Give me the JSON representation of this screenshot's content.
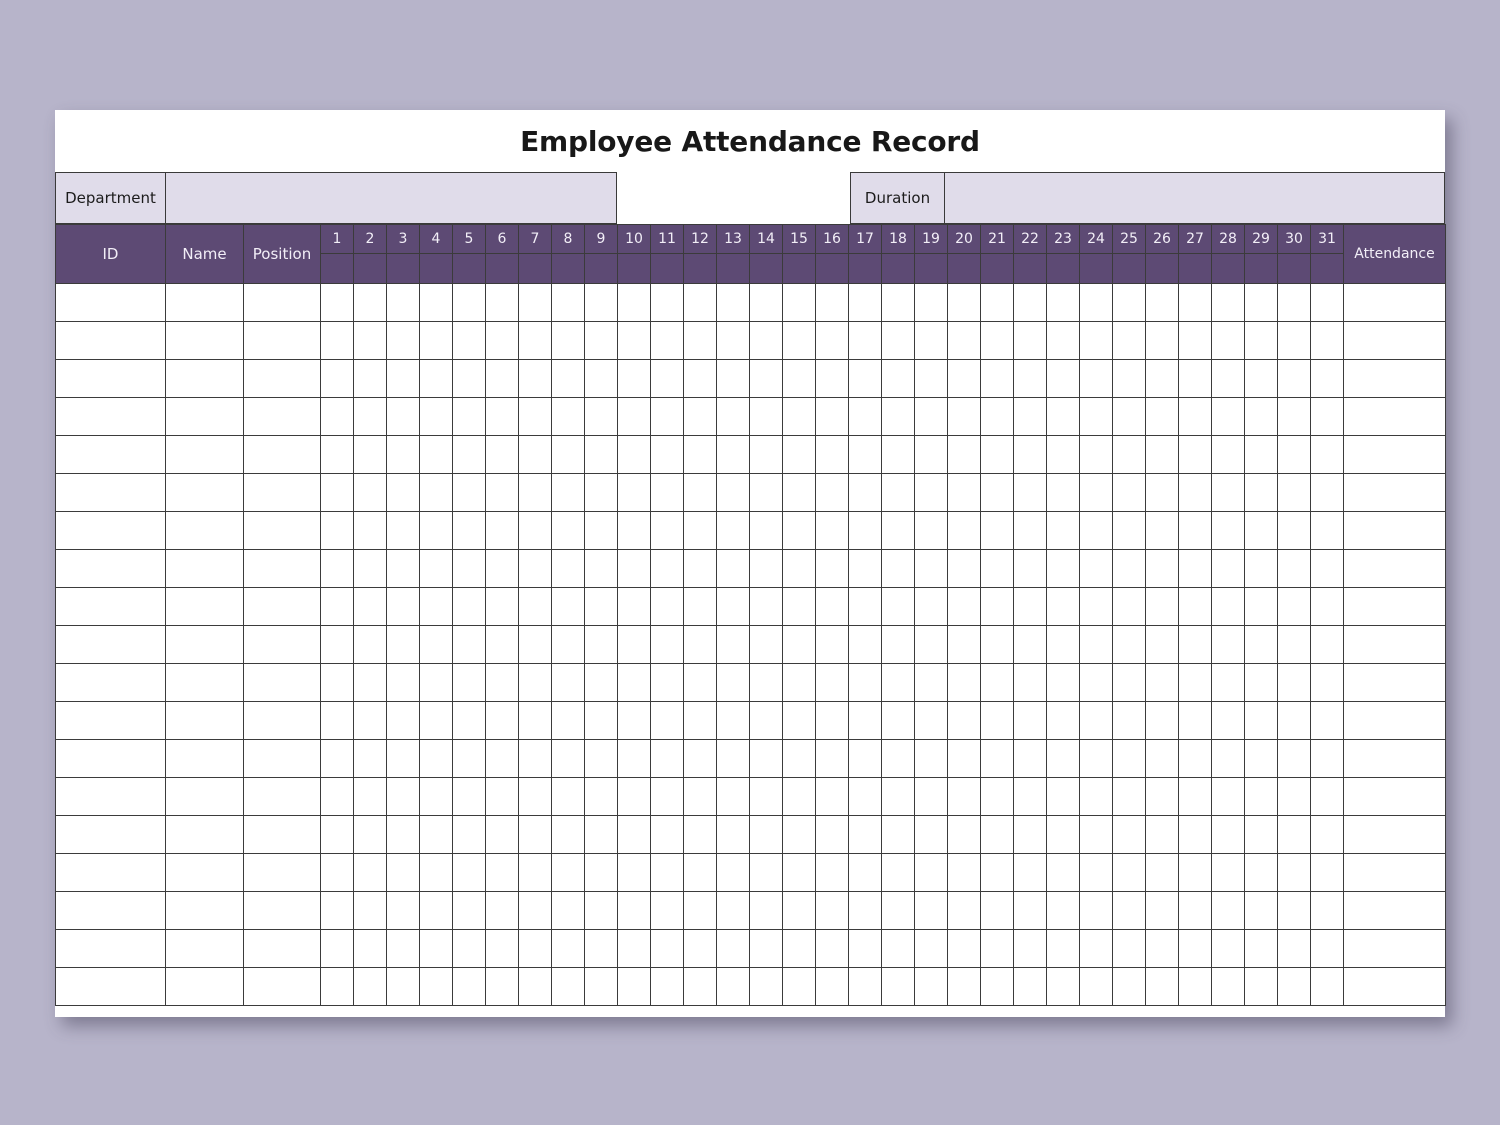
{
  "page": {
    "title": "Employee Attendance Record",
    "background_color": "#b7b4ca",
    "sheet_color": "#ffffff",
    "accent_color": "#5d4a74",
    "field_fill_color": "#e0dcea",
    "border_color": "#3b3b3b"
  },
  "meta": {
    "department": {
      "label": "Department",
      "value": "",
      "placeholder": ""
    },
    "duration": {
      "label": "Duration",
      "value": "",
      "placeholder": ""
    }
  },
  "table": {
    "headers": {
      "id": "ID",
      "name": "Name",
      "position": "Position",
      "attendance": "Attendance"
    },
    "days": [
      "1",
      "2",
      "3",
      "4",
      "5",
      "6",
      "7",
      "8",
      "9",
      "10",
      "11",
      "12",
      "13",
      "14",
      "15",
      "16",
      "17",
      "18",
      "19",
      "20",
      "21",
      "22",
      "23",
      "24",
      "25",
      "26",
      "27",
      "28",
      "29",
      "30",
      "31"
    ],
    "day_subrow_values": [
      "",
      "",
      "",
      "",
      "",
      "",
      "",
      "",
      "",
      "",
      "",
      "",
      "",
      "",
      "",
      "",
      "",
      "",
      "",
      "",
      "",
      "",
      "",
      "",
      "",
      "",
      "",
      "",
      "",
      "",
      ""
    ],
    "row_count": 19,
    "rows": [
      {
        "id": "",
        "name": "",
        "position": "",
        "days": [
          "",
          "",
          "",
          "",
          "",
          "",
          "",
          "",
          "",
          "",
          "",
          "",
          "",
          "",
          "",
          "",
          "",
          "",
          "",
          "",
          "",
          "",
          "",
          "",
          "",
          "",
          "",
          "",
          "",
          "",
          ""
        ],
        "attendance": ""
      },
      {
        "id": "",
        "name": "",
        "position": "",
        "days": [
          "",
          "",
          "",
          "",
          "",
          "",
          "",
          "",
          "",
          "",
          "",
          "",
          "",
          "",
          "",
          "",
          "",
          "",
          "",
          "",
          "",
          "",
          "",
          "",
          "",
          "",
          "",
          "",
          "",
          "",
          ""
        ],
        "attendance": ""
      },
      {
        "id": "",
        "name": "",
        "position": "",
        "days": [
          "",
          "",
          "",
          "",
          "",
          "",
          "",
          "",
          "",
          "",
          "",
          "",
          "",
          "",
          "",
          "",
          "",
          "",
          "",
          "",
          "",
          "",
          "",
          "",
          "",
          "",
          "",
          "",
          "",
          "",
          ""
        ],
        "attendance": ""
      },
      {
        "id": "",
        "name": "",
        "position": "",
        "days": [
          "",
          "",
          "",
          "",
          "",
          "",
          "",
          "",
          "",
          "",
          "",
          "",
          "",
          "",
          "",
          "",
          "",
          "",
          "",
          "",
          "",
          "",
          "",
          "",
          "",
          "",
          "",
          "",
          "",
          "",
          ""
        ],
        "attendance": ""
      },
      {
        "id": "",
        "name": "",
        "position": "",
        "days": [
          "",
          "",
          "",
          "",
          "",
          "",
          "",
          "",
          "",
          "",
          "",
          "",
          "",
          "",
          "",
          "",
          "",
          "",
          "",
          "",
          "",
          "",
          "",
          "",
          "",
          "",
          "",
          "",
          "",
          "",
          ""
        ],
        "attendance": ""
      },
      {
        "id": "",
        "name": "",
        "position": "",
        "days": [
          "",
          "",
          "",
          "",
          "",
          "",
          "",
          "",
          "",
          "",
          "",
          "",
          "",
          "",
          "",
          "",
          "",
          "",
          "",
          "",
          "",
          "",
          "",
          "",
          "",
          "",
          "",
          "",
          "",
          "",
          ""
        ],
        "attendance": ""
      },
      {
        "id": "",
        "name": "",
        "position": "",
        "days": [
          "",
          "",
          "",
          "",
          "",
          "",
          "",
          "",
          "",
          "",
          "",
          "",
          "",
          "",
          "",
          "",
          "",
          "",
          "",
          "",
          "",
          "",
          "",
          "",
          "",
          "",
          "",
          "",
          "",
          "",
          ""
        ],
        "attendance": ""
      },
      {
        "id": "",
        "name": "",
        "position": "",
        "days": [
          "",
          "",
          "",
          "",
          "",
          "",
          "",
          "",
          "",
          "",
          "",
          "",
          "",
          "",
          "",
          "",
          "",
          "",
          "",
          "",
          "",
          "",
          "",
          "",
          "",
          "",
          "",
          "",
          "",
          "",
          ""
        ],
        "attendance": ""
      },
      {
        "id": "",
        "name": "",
        "position": "",
        "days": [
          "",
          "",
          "",
          "",
          "",
          "",
          "",
          "",
          "",
          "",
          "",
          "",
          "",
          "",
          "",
          "",
          "",
          "",
          "",
          "",
          "",
          "",
          "",
          "",
          "",
          "",
          "",
          "",
          "",
          "",
          ""
        ],
        "attendance": ""
      },
      {
        "id": "",
        "name": "",
        "position": "",
        "days": [
          "",
          "",
          "",
          "",
          "",
          "",
          "",
          "",
          "",
          "",
          "",
          "",
          "",
          "",
          "",
          "",
          "",
          "",
          "",
          "",
          "",
          "",
          "",
          "",
          "",
          "",
          "",
          "",
          "",
          "",
          ""
        ],
        "attendance": ""
      },
      {
        "id": "",
        "name": "",
        "position": "",
        "days": [
          "",
          "",
          "",
          "",
          "",
          "",
          "",
          "",
          "",
          "",
          "",
          "",
          "",
          "",
          "",
          "",
          "",
          "",
          "",
          "",
          "",
          "",
          "",
          "",
          "",
          "",
          "",
          "",
          "",
          "",
          ""
        ],
        "attendance": ""
      },
      {
        "id": "",
        "name": "",
        "position": "",
        "days": [
          "",
          "",
          "",
          "",
          "",
          "",
          "",
          "",
          "",
          "",
          "",
          "",
          "",
          "",
          "",
          "",
          "",
          "",
          "",
          "",
          "",
          "",
          "",
          "",
          "",
          "",
          "",
          "",
          "",
          "",
          ""
        ],
        "attendance": ""
      },
      {
        "id": "",
        "name": "",
        "position": "",
        "days": [
          "",
          "",
          "",
          "",
          "",
          "",
          "",
          "",
          "",
          "",
          "",
          "",
          "",
          "",
          "",
          "",
          "",
          "",
          "",
          "",
          "",
          "",
          "",
          "",
          "",
          "",
          "",
          "",
          "",
          "",
          ""
        ],
        "attendance": ""
      },
      {
        "id": "",
        "name": "",
        "position": "",
        "days": [
          "",
          "",
          "",
          "",
          "",
          "",
          "",
          "",
          "",
          "",
          "",
          "",
          "",
          "",
          "",
          "",
          "",
          "",
          "",
          "",
          "",
          "",
          "",
          "",
          "",
          "",
          "",
          "",
          "",
          "",
          ""
        ],
        "attendance": ""
      },
      {
        "id": "",
        "name": "",
        "position": "",
        "days": [
          "",
          "",
          "",
          "",
          "",
          "",
          "",
          "",
          "",
          "",
          "",
          "",
          "",
          "",
          "",
          "",
          "",
          "",
          "",
          "",
          "",
          "",
          "",
          "",
          "",
          "",
          "",
          "",
          "",
          "",
          ""
        ],
        "attendance": ""
      },
      {
        "id": "",
        "name": "",
        "position": "",
        "days": [
          "",
          "",
          "",
          "",
          "",
          "",
          "",
          "",
          "",
          "",
          "",
          "",
          "",
          "",
          "",
          "",
          "",
          "",
          "",
          "",
          "",
          "",
          "",
          "",
          "",
          "",
          "",
          "",
          "",
          "",
          ""
        ],
        "attendance": ""
      },
      {
        "id": "",
        "name": "",
        "position": "",
        "days": [
          "",
          "",
          "",
          "",
          "",
          "",
          "",
          "",
          "",
          "",
          "",
          "",
          "",
          "",
          "",
          "",
          "",
          "",
          "",
          "",
          "",
          "",
          "",
          "",
          "",
          "",
          "",
          "",
          "",
          "",
          ""
        ],
        "attendance": ""
      },
      {
        "id": "",
        "name": "",
        "position": "",
        "days": [
          "",
          "",
          "",
          "",
          "",
          "",
          "",
          "",
          "",
          "",
          "",
          "",
          "",
          "",
          "",
          "",
          "",
          "",
          "",
          "",
          "",
          "",
          "",
          "",
          "",
          "",
          "",
          "",
          "",
          "",
          ""
        ],
        "attendance": ""
      },
      {
        "id": "",
        "name": "",
        "position": "",
        "days": [
          "",
          "",
          "",
          "",
          "",
          "",
          "",
          "",
          "",
          "",
          "",
          "",
          "",
          "",
          "",
          "",
          "",
          "",
          "",
          "",
          "",
          "",
          "",
          "",
          "",
          "",
          "",
          "",
          "",
          "",
          ""
        ],
        "attendance": ""
      }
    ]
  }
}
